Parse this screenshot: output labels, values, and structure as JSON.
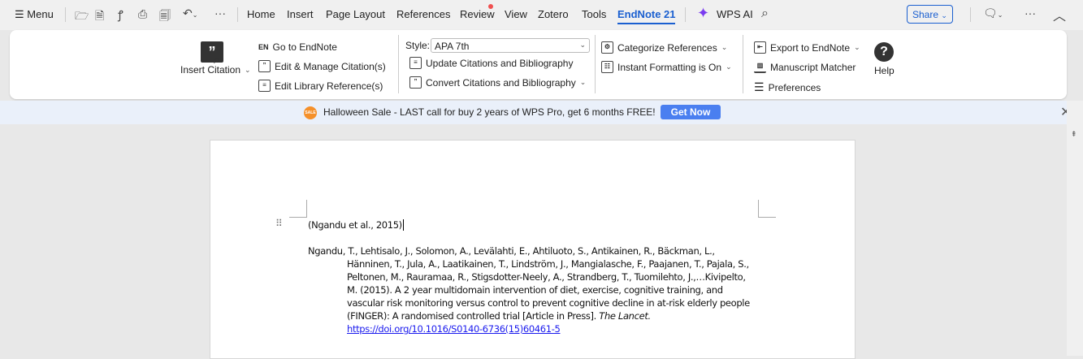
{
  "topbar": {
    "menu": "Menu",
    "tabs": [
      "Home",
      "Insert",
      "Page Layout",
      "References",
      "Review",
      "View",
      "Zotero",
      "Tools",
      "EndNote 21"
    ],
    "active_tab": "EndNote 21",
    "wps_ai": "WPS AI",
    "share": "Share"
  },
  "ribbon": {
    "insert_citation": "Insert Citation",
    "go_to_endnote": "Go to EndNote",
    "en_badge": "EN",
    "edit_manage": "Edit & Manage Citation(s)",
    "edit_library": "Edit Library Reference(s)",
    "style_label": "Style:",
    "style_value": "APA 7th",
    "update": "Update Citations and Bibliography",
    "convert": "Convert Citations and Bibliography",
    "categorize": "Categorize References",
    "instant": "Instant Formatting is On",
    "export": "Export to EndNote",
    "matcher": "Manuscript Matcher",
    "preferences": "Preferences",
    "help": "Help"
  },
  "banner": {
    "text": "Halloween Sale - LAST call for buy 2 years of WPS Pro, get 6 months FREE!",
    "button": "Get Now",
    "badge": "SALE"
  },
  "document": {
    "citation": "(Ngandu et al., 2015)",
    "reference_lines": [
      "Ngandu, T., Lehtisalo, J., Solomon, A., Levälahti, E., Ahtiluoto, S., Antikainen, R., Bäckman, L.,",
      "Hänninen, T., Jula, A., Laatikainen, T., Lindström, J., Mangialasche, F., Paajanen, T., Pajala, S.,",
      "Peltonen, M., Rauramaa, R., Stigsdotter-Neely, A., Strandberg, T., Tuomilehto, J.,…Kivipelto,",
      "M. (2015). A 2 year multidomain intervention of diet, exercise, cognitive training, and",
      "vascular risk monitoring versus control to prevent cognitive decline in at-risk elderly people",
      "(FINGER): A randomised controlled trial [Article in Press]. "
    ],
    "journal": "The Lancet.",
    "doi": "https://doi.org/10.1016/S0140-6736(15)60461-5"
  },
  "colors": {
    "accent": "#1a5fd0",
    "banner_button": "#4a7ff0",
    "review_dot": "#f05050",
    "link": "#1a1aee"
  }
}
